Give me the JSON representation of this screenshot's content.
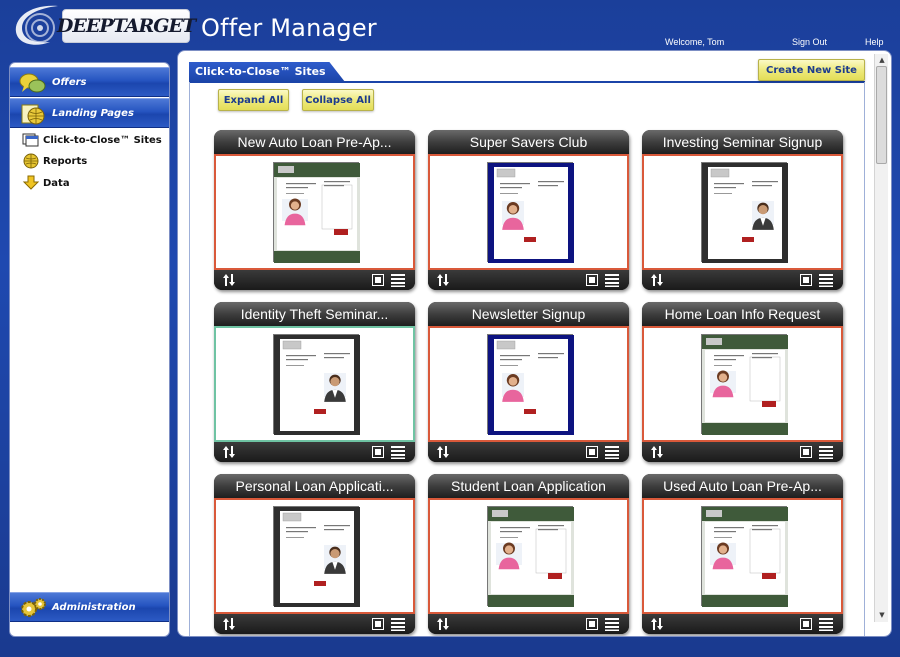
{
  "header": {
    "logo_text": "DEEPTARGET",
    "app_title": "Offer Manager",
    "welcome": "Welcome, Tom",
    "sign_out": "Sign Out",
    "help": "Help"
  },
  "sidebar": {
    "sections": [
      {
        "label": "Offers",
        "icon": "chat-bubbles-icon"
      },
      {
        "label": "Landing Pages",
        "icon": "globe-page-icon"
      }
    ],
    "links": [
      {
        "label": "Click-to-Close™ Sites",
        "icon": "site-pages-icon"
      },
      {
        "label": "Reports",
        "icon": "reports-globe-icon"
      },
      {
        "label": "Data",
        "icon": "data-download-icon"
      }
    ],
    "footer_section": {
      "label": "Administration",
      "icon": "gears-icon"
    }
  },
  "main": {
    "tab_title": "Click-to-Close™ Sites",
    "create_button": "Create New Site",
    "expand_all": "Expand All",
    "collapse_all": "Collapse All",
    "cards": [
      {
        "title": "New Auto Loan Pre-Ap...",
        "theme": "green-header",
        "border": "red",
        "photo": "woman"
      },
      {
        "title": "Super Savers Club",
        "theme": "navy-frame",
        "border": "red",
        "photo": "woman"
      },
      {
        "title": "Investing Seminar Signup",
        "theme": "dark-frame",
        "border": "red",
        "photo": "man"
      },
      {
        "title": "Identity Theft Seminar...",
        "theme": "dark-frame",
        "border": "green",
        "photo": "man"
      },
      {
        "title": "Newsletter Signup",
        "theme": "navy-frame",
        "border": "red",
        "photo": "woman"
      },
      {
        "title": "Home Loan Info Request",
        "theme": "green-header",
        "border": "red",
        "photo": "woman"
      },
      {
        "title": "Personal Loan Applicati...",
        "theme": "dark-frame",
        "border": "red",
        "photo": "man"
      },
      {
        "title": "Student Loan Application",
        "theme": "green-header",
        "border": "red",
        "photo": "woman"
      },
      {
        "title": "Used Auto Loan Pre-Ap...",
        "theme": "green-header",
        "border": "red",
        "photo": "woman"
      }
    ]
  },
  "colors": {
    "brand_blue": "#1f49b0",
    "card_border_red": "#d9593a",
    "card_border_green": "#6fc3a3",
    "button_yellow": "#eeea7e",
    "navy_frame": "#0d1380",
    "green_header": "#3f5a3a"
  }
}
